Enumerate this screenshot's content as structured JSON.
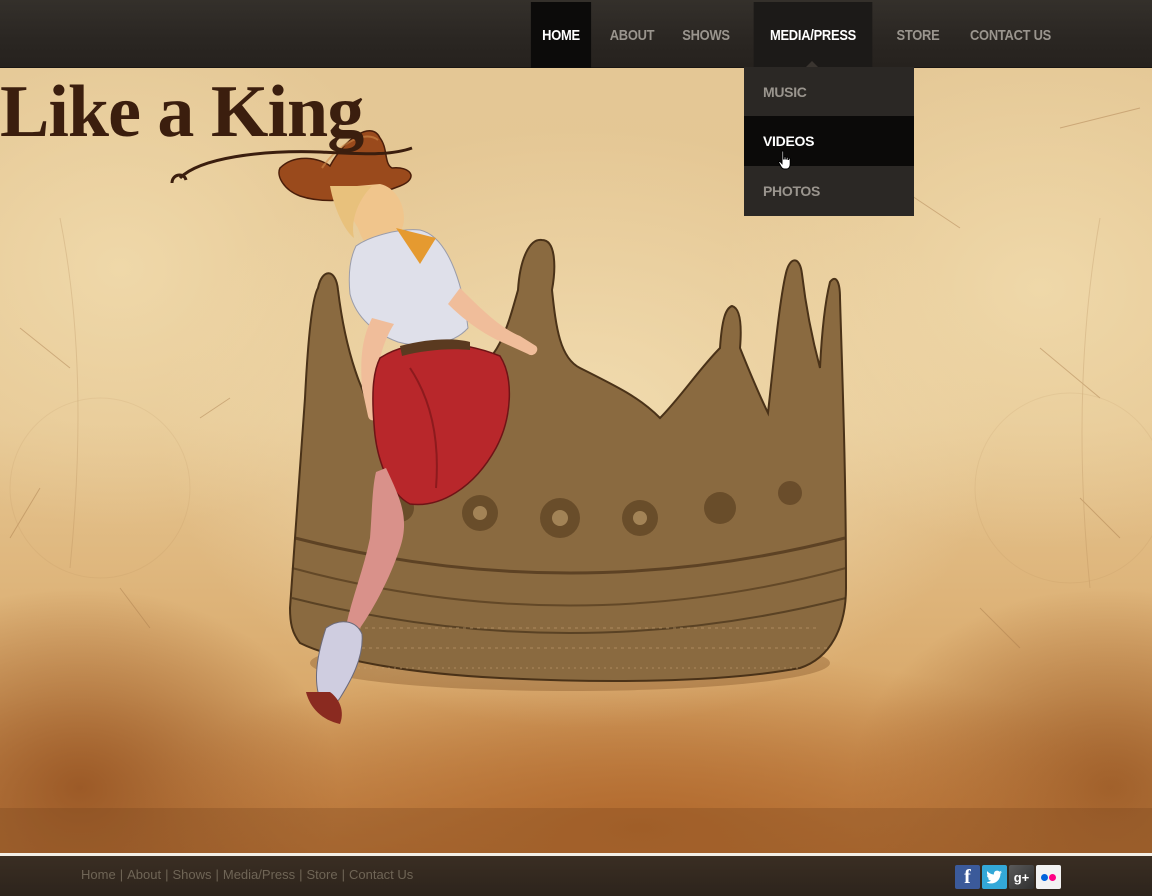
{
  "nav": {
    "items": [
      {
        "label": "HOME",
        "state": "active"
      },
      {
        "label": "ABOUT",
        "state": "normal"
      },
      {
        "label": "SHOWS",
        "state": "normal"
      },
      {
        "label": "MEDIA/PRESS",
        "state": "open"
      },
      {
        "label": "STORE",
        "state": "normal"
      },
      {
        "label": "CONTACT US",
        "state": "normal"
      }
    ]
  },
  "dropdown": {
    "items": [
      {
        "label": "MUSIC"
      },
      {
        "label": "VIDEOS",
        "state": "hover"
      },
      {
        "label": "PHOTOS"
      }
    ]
  },
  "hero": {
    "title": "Like a King"
  },
  "footer": {
    "links": [
      "Home",
      "About",
      "Shows",
      "Media/Press",
      "Store",
      "Contact Us"
    ],
    "separator": "|",
    "social": [
      {
        "icon": "facebook-icon",
        "glyph": "f",
        "color": "#3b5a9a"
      },
      {
        "icon": "twitter-icon",
        "glyph": "t",
        "color": "#33a8d8"
      },
      {
        "icon": "google-plus-icon",
        "glyph": "g+",
        "color": "#444444"
      },
      {
        "icon": "flickr-icon",
        "glyph": "",
        "color": "#f2f2f2"
      }
    ]
  },
  "colors": {
    "nav_bg": "#2a2622",
    "nav_active": "#0c0b0a",
    "nav_text": "#9a958e",
    "parchment": "#e4c795",
    "crown": "#7a5a34",
    "title_text": "#3b1e0e"
  }
}
